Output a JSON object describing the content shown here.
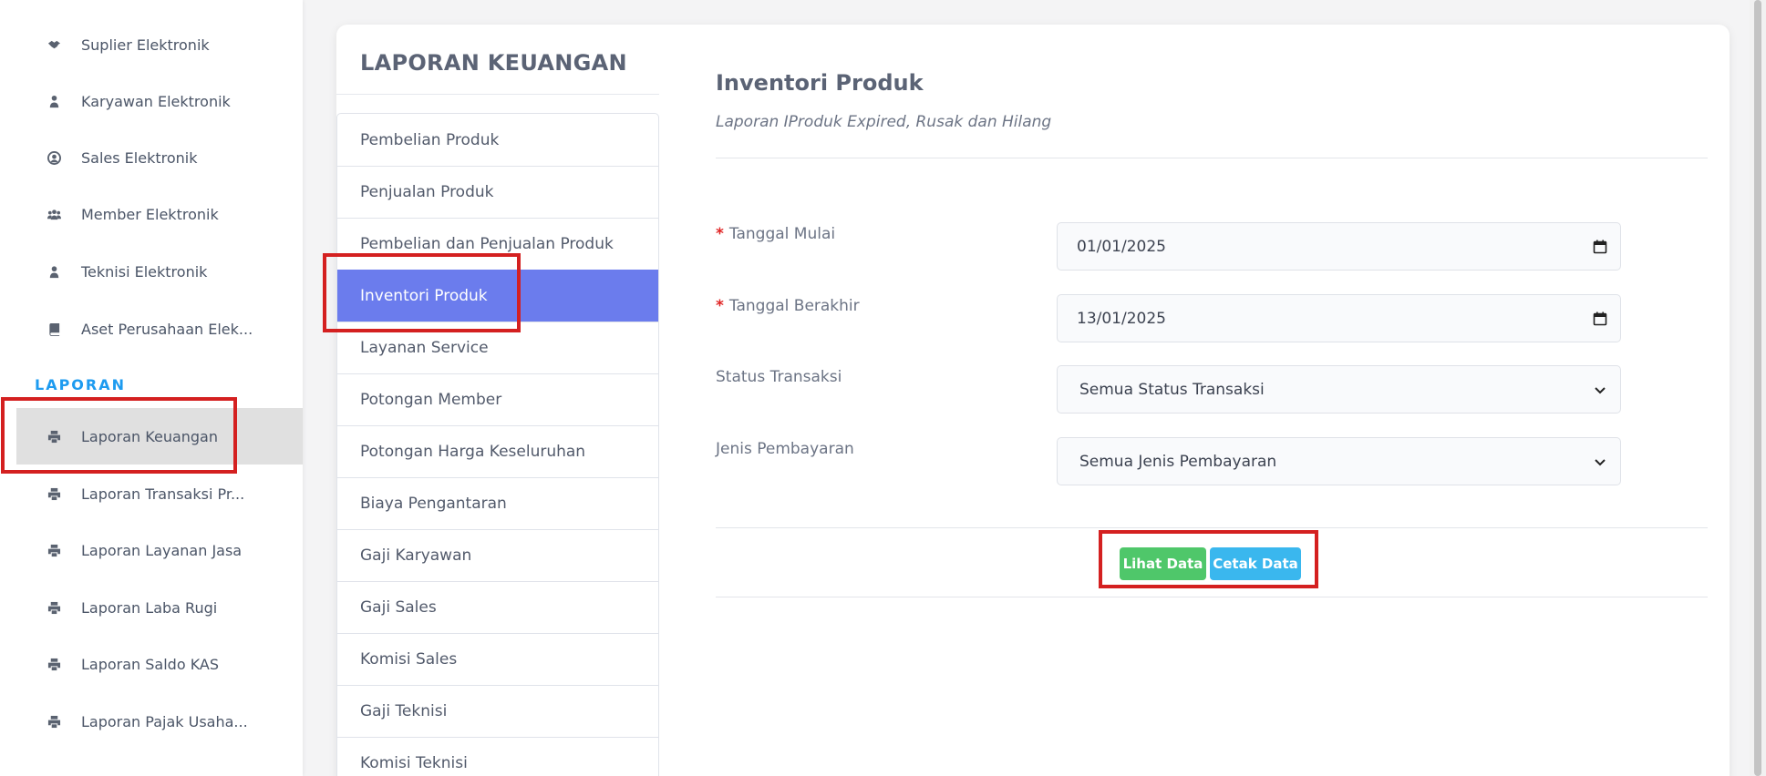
{
  "sidebar": {
    "items": [
      {
        "label": "Suplier Elektronik",
        "icon": "handshake-icon"
      },
      {
        "label": "Karyawan Elektronik",
        "icon": "user-tie-icon"
      },
      {
        "label": "Sales Elektronik",
        "icon": "user-circle-icon"
      },
      {
        "label": "Member Elektronik",
        "icon": "users-icon"
      },
      {
        "label": "Teknisi Elektronik",
        "icon": "user-icon"
      },
      {
        "label": "Aset Perusahaan Elek...",
        "icon": "book-icon"
      }
    ],
    "section_heading": "LAPORAN",
    "report_items": [
      {
        "label": "Laporan Keuangan",
        "icon": "printer-icon",
        "active": true
      },
      {
        "label": "Laporan Transaksi Pr...",
        "icon": "printer-icon"
      },
      {
        "label": "Laporan Layanan Jasa",
        "icon": "printer-icon"
      },
      {
        "label": "Laporan Laba Rugi",
        "icon": "printer-icon"
      },
      {
        "label": "Laporan Saldo KAS",
        "icon": "printer-icon"
      },
      {
        "label": "Laporan Pajak Usaha...",
        "icon": "printer-icon"
      }
    ]
  },
  "card": {
    "title": "LAPORAN KEUANGAN",
    "report_list": [
      "Pembelian Produk",
      "Penjualan Produk",
      "Pembelian dan Penjualan Produk",
      "Inventori Produk",
      "Layanan Service",
      "Potongan Member",
      "Potongan Harga Keseluruhan",
      "Biaya Pengantaran",
      "Gaji Karyawan",
      "Gaji Sales",
      "Komisi Sales",
      "Gaji Teknisi",
      "Komisi Teknisi"
    ],
    "active_report": "Inventori Produk"
  },
  "panel": {
    "title": "Inventori Produk",
    "subtitle": "Laporan IProduk Expired, Rusak dan Hilang",
    "required_mark": "*",
    "fields": {
      "start_date": {
        "label": "Tanggal Mulai",
        "value": "01/01/2025"
      },
      "end_date": {
        "label": "Tanggal Berakhir",
        "value": "13/01/2025"
      },
      "status": {
        "label": "Status Transaksi",
        "value": "Semua Status Transaksi"
      },
      "payment": {
        "label": "Jenis Pembayaran",
        "value": "Semua Jenis Pembayaran"
      }
    },
    "buttons": {
      "view": "Lihat Data",
      "print": "Cetak Data"
    }
  },
  "colors": {
    "accent_active": "#6b7ced",
    "sidebar_heading": "#1d9bf0",
    "view_button": "#4fc76a",
    "print_button": "#3ab7ee",
    "highlight": "#d42020",
    "required": "#e02424"
  }
}
